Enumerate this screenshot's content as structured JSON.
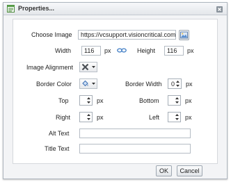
{
  "window": {
    "title": "Properties..."
  },
  "fields": {
    "choose_image_label": "Choose Image",
    "image_url": "https://vcsupport.visioncritical.com/",
    "width_label": "Width",
    "width_value": "116",
    "width_unit": "px",
    "height_label": "Height",
    "height_value": "116",
    "height_unit": "px",
    "alignment_label": "Image Alignment",
    "border_color_label": "Border Color",
    "border_width_label": "Border Width",
    "border_width_value": "0",
    "border_width_unit": "px",
    "top_label": "Top",
    "top_unit": "px",
    "bottom_label": "Bottom",
    "bottom_unit": "px",
    "right_label": "Right",
    "right_unit": "px",
    "left_label": "Left",
    "left_unit": "px",
    "alt_text_label": "Alt Text",
    "alt_text_value": "",
    "title_text_label": "Title Text",
    "title_text_value": ""
  },
  "buttons": {
    "ok": "OK",
    "cancel": "Cancel"
  },
  "colors": {
    "accent": "#3a7bd5",
    "border": "#b5bcc4"
  }
}
